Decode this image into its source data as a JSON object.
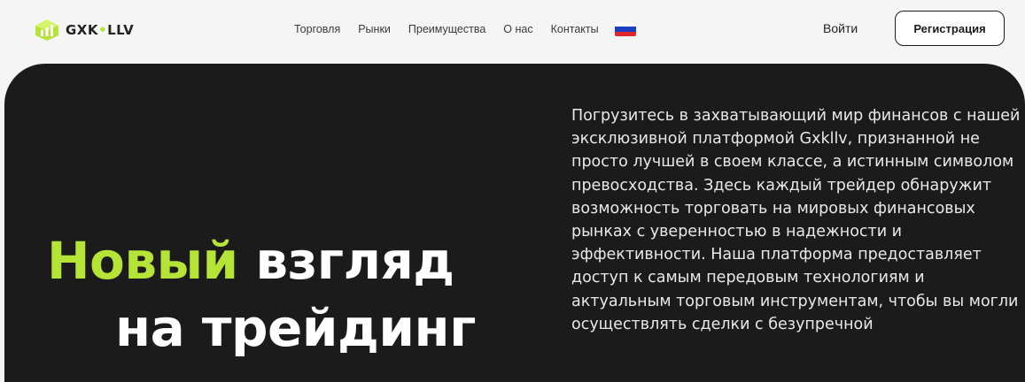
{
  "brand": {
    "logo_text": "GXK",
    "logo_dot": "•",
    "logo_text_tail": "LLV",
    "accent_color": "#b5e336"
  },
  "nav": {
    "items": [
      "Торговля",
      "Рынки",
      "Преимущества",
      "О нас",
      "Контакты"
    ],
    "language_flag": "flag-ru-icon"
  },
  "auth": {
    "login_label": "Войти",
    "register_label": "Регистрация"
  },
  "hero": {
    "headline_accent": "Новый",
    "headline_rest": " взгляд",
    "headline_line2": "на трейдинг",
    "description": "Погрузитесь в захватывающий мир финансов с нашей эксклюзивной платформой Gxkllv, признанной не просто лучшей в своем классе, а истинным символом превосходства. Здесь каждый трейдер обнаружит возможность торговать на мировых финансовых рынках с уверенностью в надежности и эффективности. Наша платформа предоставляет доступ к самым передовым технологиям и актуальным торговым инструментам, чтобы вы могли осуществлять сделки с безупречной"
  }
}
